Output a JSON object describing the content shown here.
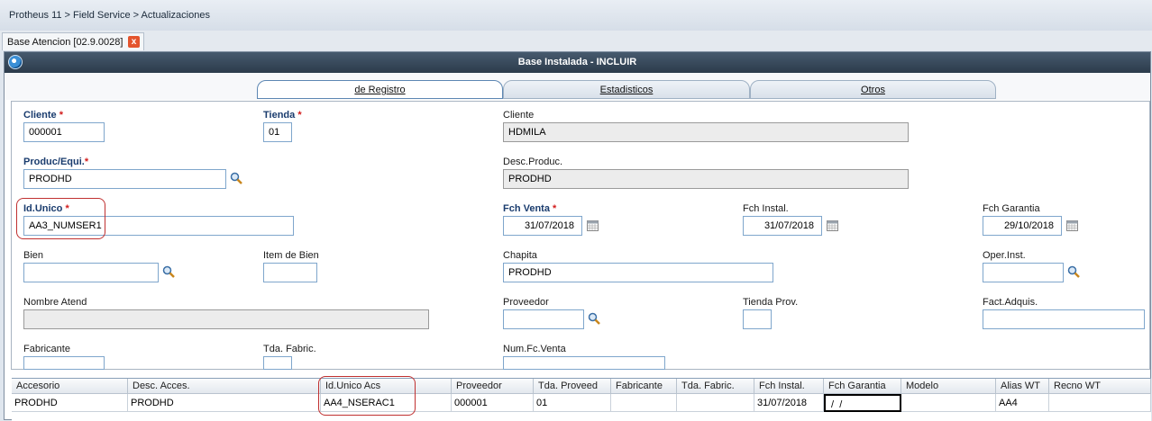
{
  "breadcrumb": "Protheus 11 > Field Service > Actualizaciones",
  "doc_tab": {
    "label": "Base Atencion [02.9.0028]",
    "close": "x"
  },
  "window_title": "Base Instalada - INCLUIR",
  "tabs": [
    {
      "label": "de Registro",
      "active": true
    },
    {
      "label": "Estadisticos",
      "active": false
    },
    {
      "label": "Otros",
      "active": false
    }
  ],
  "form": {
    "cliente": {
      "label": "Cliente",
      "value": "000001",
      "required": true
    },
    "tienda": {
      "label": "Tienda",
      "value": "01",
      "required": true
    },
    "cliente_nombre": {
      "label": "Cliente",
      "value": "HDMILA"
    },
    "produc": {
      "label": "Produc/Equi.",
      "value": "PRODHD",
      "required": true
    },
    "desc_produc": {
      "label": "Desc.Produc.",
      "value": "PRODHD"
    },
    "id_unico": {
      "label": "Id.Unico",
      "value": "AA3_NUMSER1",
      "required": true
    },
    "fch_venta": {
      "label": "Fch Venta",
      "value": "31/07/2018",
      "required": true
    },
    "fch_instal": {
      "label": "Fch Instal.",
      "value": "31/07/2018"
    },
    "fch_garantia": {
      "label": "Fch Garantia",
      "value": "29/10/2018"
    },
    "bien": {
      "label": "Bien",
      "value": ""
    },
    "item_bien": {
      "label": "Item de Bien",
      "value": ""
    },
    "chapita": {
      "label": "Chapita",
      "value": "PRODHD"
    },
    "oper_inst": {
      "label": "Oper.Inst.",
      "value": ""
    },
    "nombre_atend": {
      "label": "Nombre Atend",
      "value": ""
    },
    "proveedor": {
      "label": "Proveedor",
      "value": ""
    },
    "tienda_prov": {
      "label": "Tienda Prov.",
      "value": ""
    },
    "fact_adquis": {
      "label": "Fact.Adquis.",
      "value": ""
    },
    "fabricante": {
      "label": "Fabricante",
      "value": ""
    },
    "tda_fabric": {
      "label": "Tda. Fabric.",
      "value": ""
    },
    "num_fc_venta": {
      "label": "Num.Fc.Venta",
      "value": ""
    }
  },
  "grid": {
    "headers": [
      "Accesorio",
      "Desc. Acces.",
      "Id.Unico Acs",
      "Proveedor",
      "Tda. Proveed",
      "Fabricante",
      "Tda. Fabric.",
      "Fch Instal.",
      "Fch Garantia",
      "Modelo",
      "Alias WT",
      "Recno WT"
    ],
    "rows": [
      [
        "PRODHD",
        "PRODHD",
        "AA4_NSERAC1",
        "000001",
        "01",
        "",
        "",
        "31/07/2018",
        " /  /",
        "",
        "AA4",
        ""
      ]
    ]
  },
  "colors": {
    "titlebar": "#2c3b4b",
    "required": "#d21c1c",
    "highlight": "#c03030",
    "field_border": "#7fa6cc"
  }
}
